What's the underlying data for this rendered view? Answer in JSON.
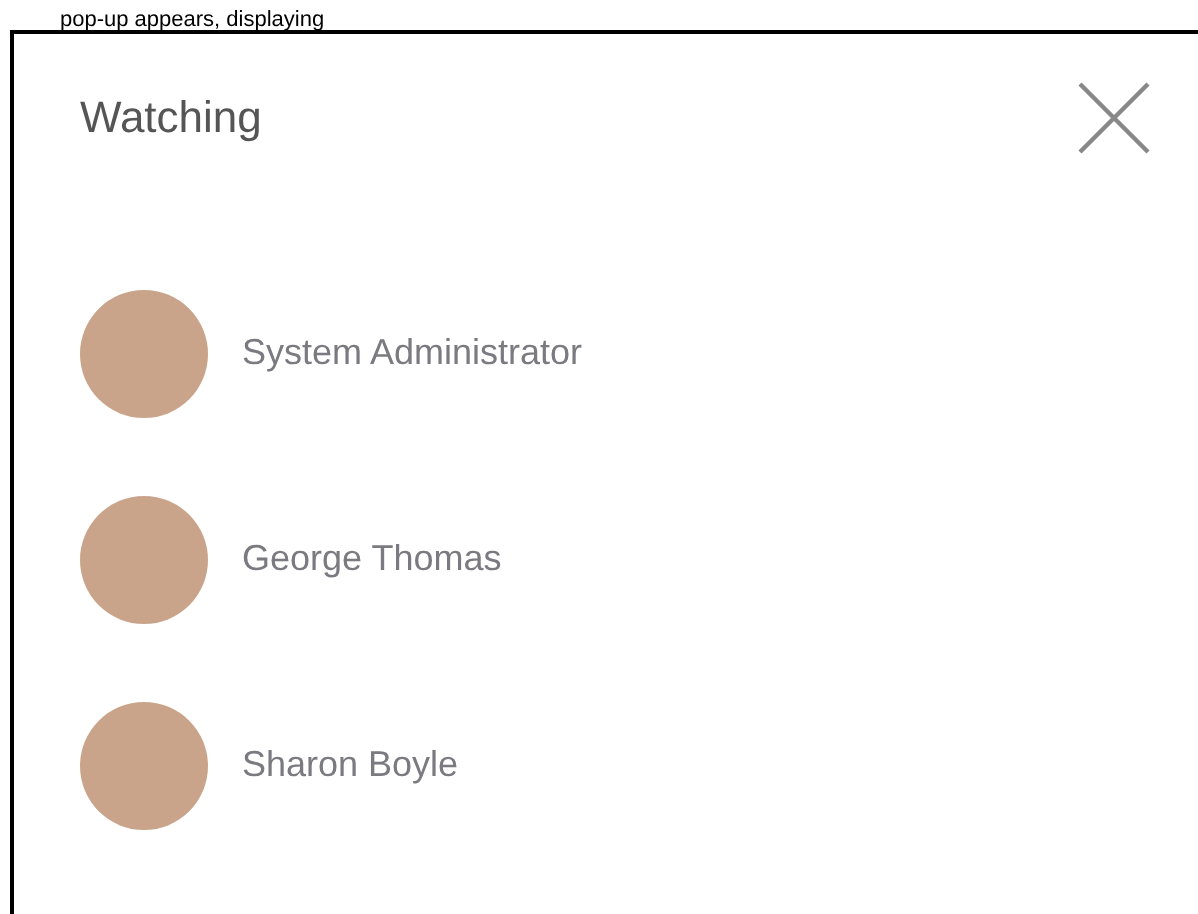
{
  "caption": "pop-up appears, displaying",
  "dialog": {
    "title": "Watching",
    "watchers": [
      {
        "name": "System Administrator"
      },
      {
        "name": "George Thomas"
      },
      {
        "name": "Sharon Boyle"
      }
    ]
  }
}
